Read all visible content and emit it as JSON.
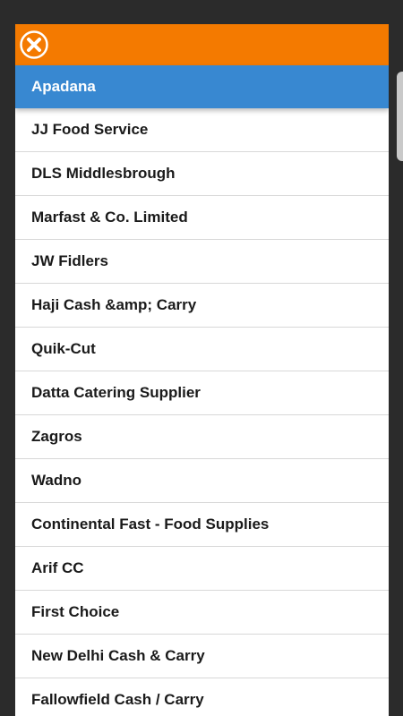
{
  "colors": {
    "header": "#f47a00",
    "selected": "#3888d1",
    "background": "#2b2b2b"
  },
  "header": {
    "close_icon": "close-icon"
  },
  "items": [
    {
      "label": "Apadana",
      "selected": true
    },
    {
      "label": "JJ Food Service"
    },
    {
      "label": "DLS Middlesbrough"
    },
    {
      "label": "Marfast & Co. Limited"
    },
    {
      "label": "JW Fidlers"
    },
    {
      "label": "Haji Cash &amp; Carry"
    },
    {
      "label": "Quik-Cut"
    },
    {
      "label": "Datta Catering Supplier"
    },
    {
      "label": "Zagros"
    },
    {
      "label": "Wadno"
    },
    {
      "label": "Continental Fast - Food Supplies"
    },
    {
      "label": "Arif CC"
    },
    {
      "label": "First Choice"
    },
    {
      "label": "New Delhi Cash & Carry"
    },
    {
      "label": "Fallowfield Cash / Carry"
    }
  ]
}
